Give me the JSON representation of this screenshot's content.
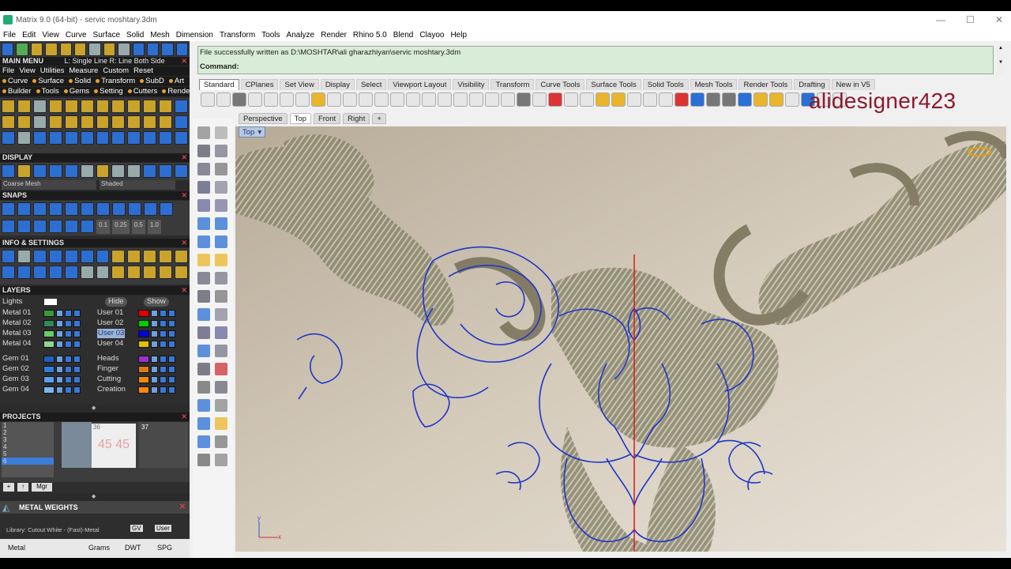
{
  "titlebar": {
    "title": "Matrix 9.0 (64-bit) - servic  moshtary.3dm",
    "minimize": "—",
    "maximize": "☐",
    "close": "✕"
  },
  "menubar": [
    "File",
    "Edit",
    "View",
    "Curve",
    "Surface",
    "Solid",
    "Mesh",
    "Dimension",
    "Transform",
    "Tools",
    "Analyze",
    "Render",
    "Rhino 5.0",
    "Blend",
    "Clayoo",
    "Help"
  ],
  "left_panel": {
    "main_menu": {
      "header": "MAIN MENU",
      "hint": "L: Single Line R: Line Both Side",
      "row1": [
        "File",
        "View",
        "Utilities",
        "Measure",
        "Custom",
        "Reset"
      ],
      "row2": [
        "Curve",
        "Surface",
        "Solid",
        "Transform",
        "SubD",
        "Art"
      ],
      "row3": [
        "Builder",
        "Tools",
        "Gems",
        "Setting",
        "Cutters",
        "Render"
      ]
    },
    "display": {
      "header": "DISPLAY",
      "mesh": "Coarse Mesh",
      "mode": "Shaded"
    },
    "snaps": {
      "header": "SNAPS",
      "values": [
        "0.1",
        "0.25",
        "0.5",
        "1.0"
      ]
    },
    "info": {
      "header": "INFO & SETTINGS"
    },
    "layers": {
      "header": "LAYERS",
      "lights": "Lights",
      "hide": "Hide",
      "show": "Show",
      "left": [
        {
          "name": "Metal 01",
          "color": "#3a9a3a"
        },
        {
          "name": "Metal 02",
          "color": "#2e8b57"
        },
        {
          "name": "Metal 03",
          "color": "#66cc66"
        },
        {
          "name": "Metal 04",
          "color": "#8fd68f"
        },
        {
          "name": "Gem 01",
          "color": "#1f5fbf"
        },
        {
          "name": "Gem 02",
          "color": "#2f7fe0"
        },
        {
          "name": "Gem 03",
          "color": "#5aa0f0"
        },
        {
          "name": "Gem 04",
          "color": "#7ab8f5"
        }
      ],
      "right": [
        {
          "name": "User 01",
          "color": "#e00000"
        },
        {
          "name": "User 02",
          "color": "#00cc00"
        },
        {
          "name": "User 03",
          "color": "#0000dd"
        },
        {
          "name": "User 04",
          "color": "#e0c000"
        },
        {
          "name": "Heads",
          "color": "#9933cc"
        },
        {
          "name": "Finger",
          "color": "#e07a10"
        },
        {
          "name": "Cutting",
          "color": "#f08a00"
        },
        {
          "name": "Creation",
          "color": "#ff8800"
        }
      ]
    },
    "projects": {
      "header": "PROJECTS",
      "rows": [
        "1",
        "2",
        "3",
        "4",
        "5",
        "6"
      ],
      "thumb_a": "36",
      "thumb_b": "37",
      "mgr": "Mgr",
      "thumb_text": "45 45"
    },
    "metal_weights": {
      "header": "METAL WEIGHTS",
      "library": "Library: Cutout White - (Fast)-Metal",
      "gv": "GV",
      "user": "User",
      "columns": [
        "Metal",
        "Grams",
        "DWT",
        "SPG"
      ]
    }
  },
  "command": {
    "history": "File successfully written as D:\\MOSHTAR\\ali  gharazhiyan\\servic  moshtary.3dm",
    "prompt": "Command:"
  },
  "toolbar_tabs": [
    "Standard",
    "CPlanes",
    "Set View",
    "Display",
    "Select",
    "Viewport Layout",
    "Visibility",
    "Transform",
    "Curve Tools",
    "Surface Tools",
    "Solid Tools",
    "Mesh Tools",
    "Render Tools",
    "Drafting",
    "New in V5"
  ],
  "brand": "alidesigner423",
  "viewport_tabs": [
    "Perspective",
    "Top",
    "Front",
    "Right",
    "+"
  ],
  "viewport": {
    "name": "Top",
    "dropdown": "▾",
    "axis_x": "x",
    "axis_y": "y"
  }
}
